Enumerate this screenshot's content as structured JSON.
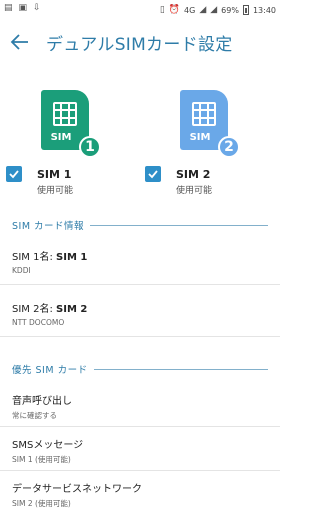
{
  "status_bar": {
    "left_icons": [
      "signal-icon",
      "image-icon",
      "download-icon"
    ],
    "network": "4G",
    "battery": "69%",
    "time": "13:40"
  },
  "app_bar": {
    "title": "デュアルSIMカード設定"
  },
  "sims": [
    {
      "badge_label": "SIM",
      "number": "1",
      "name": "SIM 1",
      "status": "使用可能",
      "color": "#1b9e7a",
      "checked": true
    },
    {
      "badge_label": "SIM",
      "number": "2",
      "name": "SIM 2",
      "status": "使用可能",
      "color": "#6aa8e8",
      "checked": true
    }
  ],
  "sim_info": {
    "header": "SIM カード情報",
    "items": [
      {
        "label": "SIM 1名: ",
        "value": "SIM 1",
        "carrier": "KDDI"
      },
      {
        "label": "SIM 2名: ",
        "value": "SIM 2",
        "carrier": "NTT DOCOMO"
      }
    ]
  },
  "preferred": {
    "header": "優先 SIM カード",
    "items": [
      {
        "title": "音声呼び出し",
        "sub": "常に確認する"
      },
      {
        "title": "SMSメッセージ",
        "sub": "SIM 1 (使用可能)"
      },
      {
        "title": "データサービスネットワーク",
        "sub": "SIM 2 (使用可能)"
      }
    ]
  },
  "colors": {
    "accent": "#2e7ca8",
    "checkbox": "#2e8fc8"
  }
}
